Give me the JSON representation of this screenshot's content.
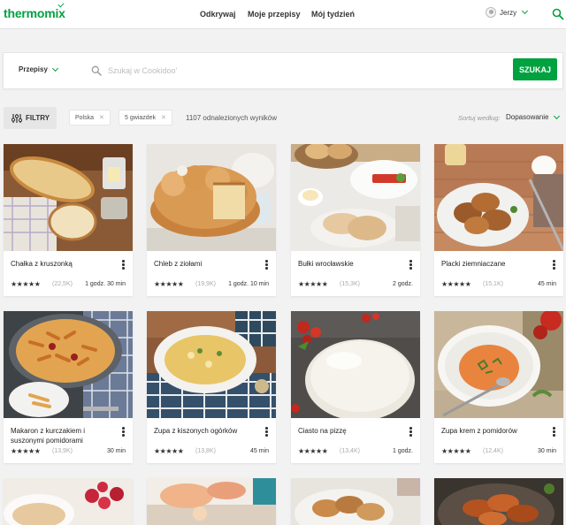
{
  "header": {
    "logo": "thermomix",
    "nav": [
      "Odkrywaj",
      "Moje przepisy",
      "Mój tydzień"
    ],
    "user_name": "Jerzy"
  },
  "search": {
    "scope": "Przepisy",
    "placeholder": "Szukaj w Cookidoo'",
    "button": "SZUKAJ"
  },
  "filters": {
    "button": "FILTRY",
    "chips": [
      "Polska",
      "5 gwiazdek"
    ],
    "results": "1107 odnalezionych wyników",
    "sort_label": "Sortuj według:",
    "sort_value": "Dopasowanie"
  },
  "recipes": [
    {
      "title": "Chałka z kruszonką",
      "stars": "★★★★★",
      "count": "(22,5K)",
      "time": "1 godz. 30 min"
    },
    {
      "title": "Chleb z ziołami",
      "stars": "★★★★★",
      "count": "(19,9K)",
      "time": "1 godz. 10 min"
    },
    {
      "title": "Bułki wrocławskie",
      "stars": "★★★★★",
      "count": "(15,3K)",
      "time": "2 godz."
    },
    {
      "title": "Placki ziemniaczane",
      "stars": "★★★★★",
      "count": "(15,1K)",
      "time": "45 min"
    },
    {
      "title": "Makaron z kurczakiem i suszonymi pomidorami",
      "stars": "★★★★★",
      "count": "(13,9K)",
      "time": "30 min"
    },
    {
      "title": "Zupa z kiszonych ogórków",
      "stars": "★★★★★",
      "count": "(13,8K)",
      "time": "45 min"
    },
    {
      "title": "Ciasto na pizzę",
      "stars": "★★★★★",
      "count": "(13,4K)",
      "time": "1 godz."
    },
    {
      "title": "Zupa krem z pomidorów",
      "stars": "★★★★★",
      "count": "(12,4K)",
      "time": "30 min"
    }
  ],
  "colors": {
    "accent": "#00a13f",
    "background": "#f2f2f2"
  },
  "icons": [
    "search-icon",
    "chevron-down-icon",
    "filter-sliders-icon",
    "close-icon",
    "more-vertical-icon",
    "star-icon",
    "avatar"
  ]
}
